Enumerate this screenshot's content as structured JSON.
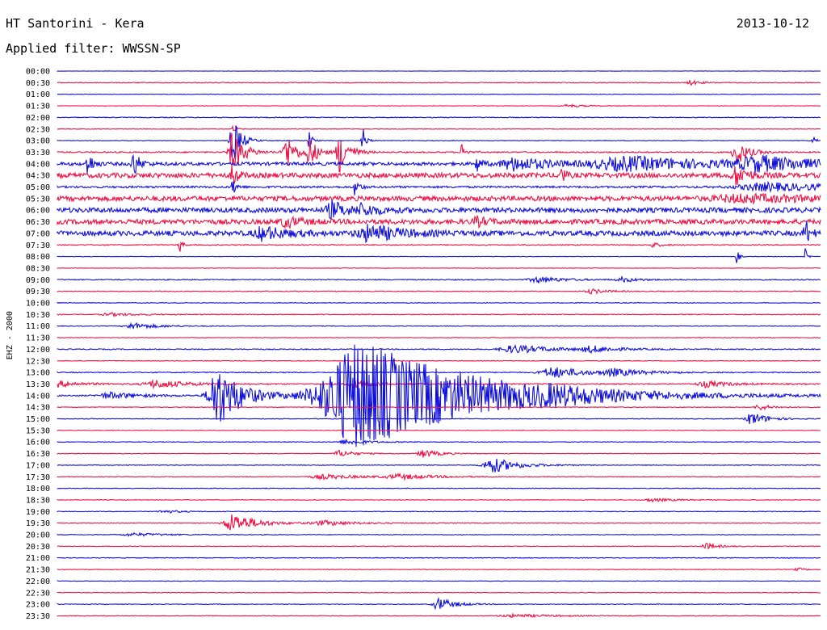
{
  "header": {
    "title": "HT Santorini - Kera",
    "date": "2013-10-12",
    "filter": "Applied filter: WWSSN-SP"
  },
  "chart_data": {
    "type": "line",
    "ylabel": "EHZ - 2000",
    "colors": {
      "blue": "#1010dd",
      "red": "#ee1144"
    },
    "traces": [
      {
        "label": "00:00",
        "color": "blue",
        "noise": 0.2,
        "events": []
      },
      {
        "label": "00:30",
        "color": "red",
        "noise": 0.5,
        "events": [
          {
            "t": 0.83,
            "amp": 3,
            "dur": 0.012
          }
        ]
      },
      {
        "label": "01:00",
        "color": "blue",
        "noise": 0.3,
        "events": []
      },
      {
        "label": "01:30",
        "color": "red",
        "noise": 0.3,
        "events": [
          {
            "t": 0.67,
            "amp": 2,
            "dur": 0.02
          }
        ]
      },
      {
        "label": "02:00",
        "color": "blue",
        "noise": 0.5,
        "events": []
      },
      {
        "label": "02:30",
        "color": "red",
        "noise": 0.3,
        "events": [
          {
            "t": 0.23,
            "amp": 4,
            "dur": 0.005
          }
        ]
      },
      {
        "label": "03:00",
        "color": "blue",
        "noise": 0.4,
        "events": [
          {
            "t": 0.23,
            "amp": 30,
            "dur": 0.01
          },
          {
            "t": 0.33,
            "amp": 12,
            "dur": 0.004
          },
          {
            "t": 0.4,
            "amp": 18,
            "dur": 0.004
          },
          {
            "t": 0.99,
            "amp": 6,
            "dur": 0.004
          }
        ]
      },
      {
        "label": "03:30",
        "color": "red",
        "noise": 0.8,
        "events": [
          {
            "t": 0.23,
            "amp": 26,
            "dur": 0.014
          },
          {
            "t": 0.3,
            "amp": 22,
            "dur": 0.012
          },
          {
            "t": 0.33,
            "amp": 18,
            "dur": 0.01
          },
          {
            "t": 0.37,
            "amp": 26,
            "dur": 0.012
          },
          {
            "t": 0.53,
            "amp": 14,
            "dur": 0.004
          },
          {
            "t": 0.89,
            "amp": 16,
            "dur": 0.014
          }
        ]
      },
      {
        "label": "04:00",
        "color": "blue",
        "noise": 2.0,
        "events": [
          {
            "t": 0.04,
            "amp": 16,
            "dur": 0.006
          },
          {
            "t": 0.1,
            "amp": 16,
            "dur": 0.008
          },
          {
            "t": 0.55,
            "amp": 10,
            "dur": 0.006
          },
          {
            "t": 0.6,
            "amp": 8,
            "dur": 0.05
          },
          {
            "t": 0.75,
            "amp": 8,
            "dur": 0.12
          },
          {
            "t": 0.92,
            "amp": 8,
            "dur": 0.07
          }
        ]
      },
      {
        "label": "04:30",
        "color": "red",
        "noise": 3.0,
        "events": [
          {
            "t": 0.23,
            "amp": 20,
            "dur": 0.005
          },
          {
            "t": 0.66,
            "amp": 14,
            "dur": 0.004
          },
          {
            "t": 0.89,
            "amp": 12,
            "dur": 0.014
          }
        ]
      },
      {
        "label": "05:00",
        "color": "blue",
        "noise": 1.2,
        "events": [
          {
            "t": 0.23,
            "amp": 14,
            "dur": 0.004
          },
          {
            "t": 0.39,
            "amp": 10,
            "dur": 0.006
          },
          {
            "t": 0.93,
            "amp": 5,
            "dur": 0.1
          }
        ]
      },
      {
        "label": "05:30",
        "color": "red",
        "noise": 3.0,
        "events": [
          {
            "t": 0.9,
            "amp": 4,
            "dur": 0.1
          }
        ]
      },
      {
        "label": "06:00",
        "color": "blue",
        "noise": 3.0,
        "events": [
          {
            "t": 0.36,
            "amp": 10,
            "dur": 0.02
          },
          {
            "t": 0.4,
            "amp": 6,
            "dur": 0.02
          }
        ]
      },
      {
        "label": "06:30",
        "color": "red",
        "noise": 3.0,
        "events": [
          {
            "t": 0.3,
            "amp": 6,
            "dur": 0.02
          },
          {
            "t": 0.55,
            "amp": 5,
            "dur": 0.015
          }
        ]
      },
      {
        "label": "07:00",
        "color": "blue",
        "noise": 3.0,
        "events": [
          {
            "t": 0.27,
            "amp": 8,
            "dur": 0.03
          },
          {
            "t": 0.41,
            "amp": 10,
            "dur": 0.04
          },
          {
            "t": 0.98,
            "amp": 18,
            "dur": 0.006
          }
        ]
      },
      {
        "label": "07:30",
        "color": "red",
        "noise": 0.6,
        "events": [
          {
            "t": 0.16,
            "amp": 14,
            "dur": 0.003
          },
          {
            "t": 0.78,
            "amp": 3,
            "dur": 0.01
          }
        ]
      },
      {
        "label": "08:00",
        "color": "blue",
        "noise": 0.3,
        "events": [
          {
            "t": 0.89,
            "amp": 10,
            "dur": 0.003
          },
          {
            "t": 0.98,
            "amp": 10,
            "dur": 0.003
          }
        ]
      },
      {
        "label": "08:30",
        "color": "red",
        "noise": 0.3,
        "events": []
      },
      {
        "label": "09:00",
        "color": "blue",
        "noise": 0.6,
        "events": [
          {
            "t": 0.63,
            "amp": 4,
            "dur": 0.03
          },
          {
            "t": 0.74,
            "amp": 3,
            "dur": 0.02
          }
        ]
      },
      {
        "label": "09:30",
        "color": "red",
        "noise": 0.5,
        "events": [
          {
            "t": 0.7,
            "amp": 3,
            "dur": 0.02
          }
        ]
      },
      {
        "label": "10:00",
        "color": "blue",
        "noise": 0.4,
        "events": []
      },
      {
        "label": "10:30",
        "color": "red",
        "noise": 0.5,
        "events": [
          {
            "t": 0.07,
            "amp": 2,
            "dur": 0.03
          }
        ]
      },
      {
        "label": "11:00",
        "color": "blue",
        "noise": 0.4,
        "events": [
          {
            "t": 0.1,
            "amp": 4,
            "dur": 0.03
          }
        ]
      },
      {
        "label": "11:30",
        "color": "red",
        "noise": 0.4,
        "events": []
      },
      {
        "label": "12:00",
        "color": "blue",
        "noise": 0.6,
        "events": [
          {
            "t": 0.6,
            "amp": 5,
            "dur": 0.05
          },
          {
            "t": 0.7,
            "amp": 4,
            "dur": 0.03
          }
        ]
      },
      {
        "label": "12:30",
        "color": "red",
        "noise": 0.4,
        "events": []
      },
      {
        "label": "13:00",
        "color": "blue",
        "noise": 0.6,
        "events": [
          {
            "t": 0.65,
            "amp": 7,
            "dur": 0.04
          },
          {
            "t": 0.73,
            "amp": 4,
            "dur": 0.04
          }
        ]
      },
      {
        "label": "13:30",
        "color": "red",
        "noise": 0.7,
        "events": [
          {
            "t": 0.0,
            "amp": 4,
            "dur": 0.03
          },
          {
            "t": 0.13,
            "amp": 5,
            "dur": 0.04
          },
          {
            "t": 0.39,
            "amp": 5,
            "dur": 0.03
          },
          {
            "t": 0.85,
            "amp": 4,
            "dur": 0.03
          }
        ]
      },
      {
        "label": "14:00",
        "color": "blue",
        "noise": 0.8,
        "events": [
          {
            "t": 0.07,
            "amp": 4,
            "dur": 0.04
          },
          {
            "t": 0.21,
            "amp": 40,
            "dur": 0.03
          },
          {
            "t": 0.4,
            "amp": 70,
            "dur": 0.14
          },
          {
            "t": 0.65,
            "amp": 4,
            "dur": 0.05
          }
        ]
      },
      {
        "label": "14:30",
        "color": "red",
        "noise": 0.4,
        "events": [
          {
            "t": 0.92,
            "amp": 4,
            "dur": 0.015
          }
        ]
      },
      {
        "label": "15:00",
        "color": "blue",
        "noise": 0.4,
        "events": [
          {
            "t": 0.91,
            "amp": 8,
            "dur": 0.02
          }
        ]
      },
      {
        "label": "15:30",
        "color": "red",
        "noise": 0.3,
        "events": []
      },
      {
        "label": "16:00",
        "color": "blue",
        "noise": 0.4,
        "events": [
          {
            "t": 0.38,
            "amp": 3,
            "dur": 0.03
          }
        ]
      },
      {
        "label": "16:30",
        "color": "red",
        "noise": 0.4,
        "events": [
          {
            "t": 0.37,
            "amp": 4,
            "dur": 0.02
          },
          {
            "t": 0.48,
            "amp": 5,
            "dur": 0.02
          }
        ]
      },
      {
        "label": "17:00",
        "color": "blue",
        "noise": 0.4,
        "events": [
          {
            "t": 0.57,
            "amp": 10,
            "dur": 0.03
          }
        ]
      },
      {
        "label": "17:30",
        "color": "red",
        "noise": 0.4,
        "events": [
          {
            "t": 0.35,
            "amp": 3,
            "dur": 0.05
          },
          {
            "t": 0.45,
            "amp": 3,
            "dur": 0.05
          }
        ]
      },
      {
        "label": "18:00",
        "color": "blue",
        "noise": 0.4,
        "events": []
      },
      {
        "label": "18:30",
        "color": "red",
        "noise": 0.4,
        "events": [
          {
            "t": 0.78,
            "amp": 2,
            "dur": 0.03
          }
        ]
      },
      {
        "label": "19:00",
        "color": "blue",
        "noise": 0.4,
        "events": [
          {
            "t": 0.14,
            "amp": 2,
            "dur": 0.02
          }
        ]
      },
      {
        "label": "19:30",
        "color": "red",
        "noise": 0.4,
        "events": [
          {
            "t": 0.23,
            "amp": 12,
            "dur": 0.03
          },
          {
            "t": 0.35,
            "amp": 3,
            "dur": 0.04
          }
        ]
      },
      {
        "label": "20:00",
        "color": "blue",
        "noise": 0.4,
        "events": [
          {
            "t": 0.1,
            "amp": 2,
            "dur": 0.04
          }
        ]
      },
      {
        "label": "20:30",
        "color": "red",
        "noise": 0.4,
        "events": [
          {
            "t": 0.85,
            "amp": 4,
            "dur": 0.015
          }
        ]
      },
      {
        "label": "21:00",
        "color": "blue",
        "noise": 0.4,
        "events": []
      },
      {
        "label": "21:30",
        "color": "red",
        "noise": 0.4,
        "events": [
          {
            "t": 0.97,
            "amp": 2,
            "dur": 0.01
          }
        ]
      },
      {
        "label": "22:00",
        "color": "blue",
        "noise": 0.3,
        "events": []
      },
      {
        "label": "22:30",
        "color": "red",
        "noise": 0.4,
        "events": []
      },
      {
        "label": "23:00",
        "color": "blue",
        "noise": 0.4,
        "events": [
          {
            "t": 0.5,
            "amp": 8,
            "dur": 0.02
          }
        ]
      },
      {
        "label": "23:30",
        "color": "red",
        "noise": 0.4,
        "events": [
          {
            "t": 0.6,
            "amp": 2,
            "dur": 0.05
          }
        ]
      }
    ]
  }
}
